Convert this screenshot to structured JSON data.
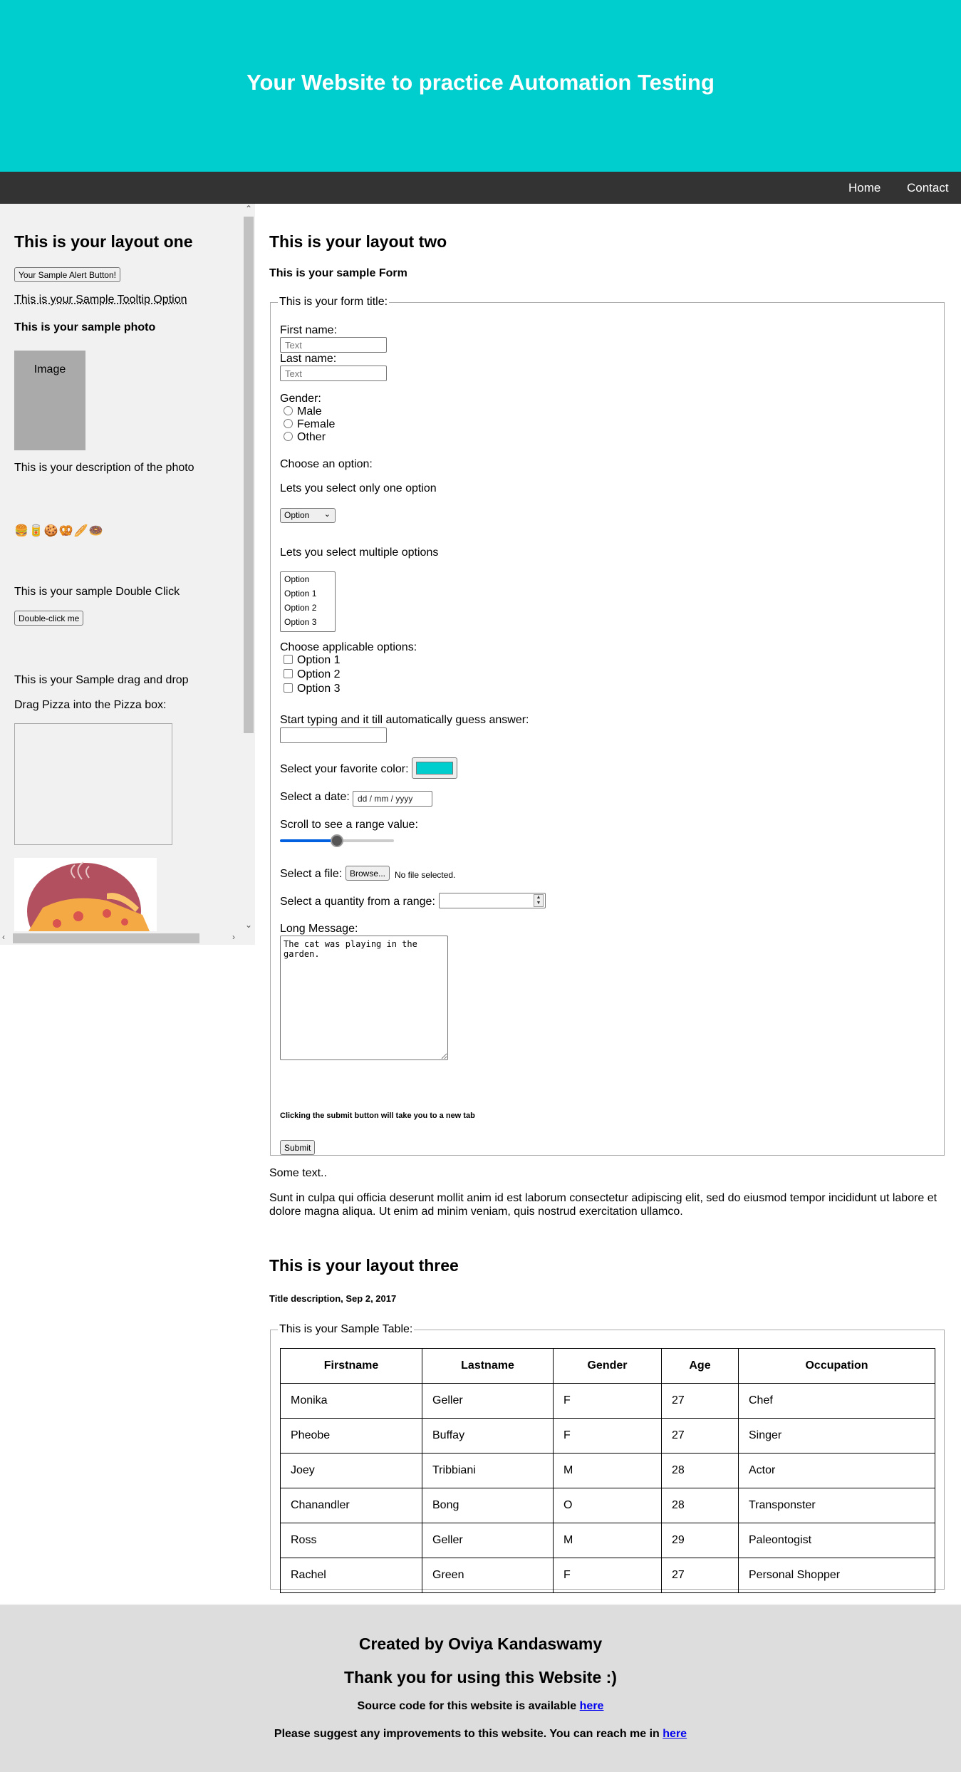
{
  "header": {
    "title": "Your Website to practice Automation Testing"
  },
  "nav": {
    "home": "Home",
    "contact": "Contact"
  },
  "layout_one": {
    "heading": "This is your layout one",
    "alert_button": "Your Sample Alert Button!",
    "tooltip": "This is your Sample Tooltip Option",
    "photo_heading": "This is your sample photo",
    "photo_placeholder": "Image",
    "photo_description": "This is your description of the photo",
    "emojis": "🍔🥫🍪🥨🥖🍩",
    "double_click_label": "This is your sample Double Click",
    "double_click_button": "Double-click me",
    "drag_drop_label": "This is your Sample drag and drop",
    "drag_instruction": "Drag Pizza into the Pizza box:"
  },
  "layout_two": {
    "heading": "This is your layout two",
    "subheading": "This is your sample Form",
    "form_title": "This is your form title:",
    "first_name_label": "First name:",
    "first_name_placeholder": "Text",
    "last_name_label": "Last name:",
    "last_name_placeholder": "Text",
    "gender_label": "Gender:",
    "gender_options": [
      "Male",
      "Female",
      "Other"
    ],
    "choose_label": "Choose an option:",
    "single_select_label": "Lets you select only one option",
    "single_select_value": "Option",
    "multi_select_label": "Lets you select multiple options",
    "multi_select_options": [
      "Option",
      "Option 1",
      "Option 2",
      "Option 3"
    ],
    "checkbox_label": "Choose applicable options:",
    "checkbox_options": [
      "Option 1",
      "Option 2",
      "Option 3"
    ],
    "autocomplete_label": "Start typing and it till automatically guess answer:",
    "color_label": "Select your favorite color:",
    "color_value": "#00cdcd",
    "date_label": "Select a date:",
    "date_placeholder": "dd / mm / yyyy",
    "range_label": "Scroll to see a range value:",
    "range_value": 0.5,
    "file_label": "Select a file:",
    "file_button": "Browse...",
    "file_status": "No file selected.",
    "quantity_label": "Select a quantity from a range:",
    "message_label": "Long Message:",
    "message_value": "The cat was playing in the garden.",
    "submit_note": "Clicking the submit button will take you to a new tab",
    "submit_button": "Submit",
    "some_text": "Some text..",
    "paragraph": "Sunt in culpa qui officia deserunt mollit anim id est laborum consectetur adipiscing elit, sed do eiusmod tempor incididunt ut labore et dolore magna aliqua. Ut enim ad minim veniam, quis nostrud exercitation ullamco."
  },
  "layout_three": {
    "heading": "This is your layout three",
    "description": "Title description, Sep 2, 2017",
    "table_title": "This is your Sample Table:",
    "columns": [
      "Firstname",
      "Lastname",
      "Gender",
      "Age",
      "Occupation"
    ],
    "rows": [
      [
        "Monika",
        "Geller",
        "F",
        "27",
        "Chef"
      ],
      [
        "Pheobe",
        "Buffay",
        "F",
        "27",
        "Singer"
      ],
      [
        "Joey",
        "Tribbiani",
        "M",
        "28",
        "Actor"
      ],
      [
        "Chanandler",
        "Bong",
        "O",
        "28",
        "Transponster"
      ],
      [
        "Ross",
        "Geller",
        "M",
        "29",
        "Paleontogist"
      ],
      [
        "Rachel",
        "Green",
        "F",
        "27",
        "Personal Shopper"
      ]
    ]
  },
  "footer": {
    "created_by": "Created by Oviya Kandaswamy",
    "thanks": "Thank you for using this Website :)",
    "source_text": "Source code for this website is available",
    "source_link": "here",
    "suggest_text": "Please suggest any improvements to this website. You can reach me in",
    "suggest_link": "here"
  },
  "colors": {
    "accent": "#00cdcd",
    "nav_bg": "#333333",
    "footer_bg": "#dddddd"
  },
  "icons": {
    "scroll_up": "chevron-up-icon",
    "scroll_down": "chevron-down-icon",
    "scroll_left": "chevron-left-icon",
    "scroll_right": "chevron-right-icon",
    "select_arrow": "chevron-down-icon"
  }
}
